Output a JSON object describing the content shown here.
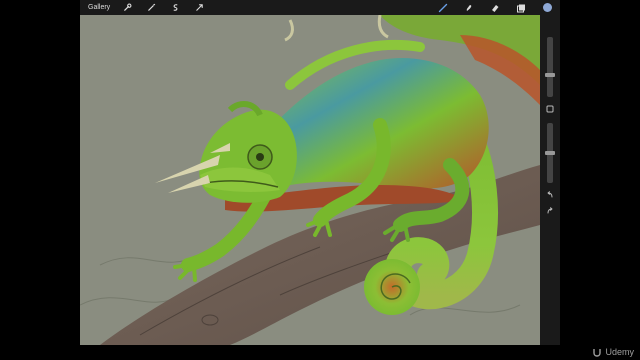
{
  "toolbar": {
    "gallery_label": "Gallery",
    "tools_left": [
      "wrench-icon",
      "magic-wand-icon",
      "selection-icon",
      "transform-arrow-icon"
    ],
    "tools_right": [
      "brush-icon",
      "smudge-icon",
      "eraser-icon",
      "layers-icon"
    ],
    "brush_color": "#6aa0e8",
    "active_color": "#8fa9d6"
  },
  "sidebar": {
    "size_slider_level": 0.35,
    "opacity_slider_level": 0.5
  },
  "watermark": {
    "text": "Udemy"
  },
  "colors": {
    "canvas_background": "#8a8d80",
    "branch": "#6e5e54",
    "chameleon_green": "#78b82c",
    "chameleon_blue": "#3f8fa0",
    "chameleon_red": "#a04a2a"
  }
}
